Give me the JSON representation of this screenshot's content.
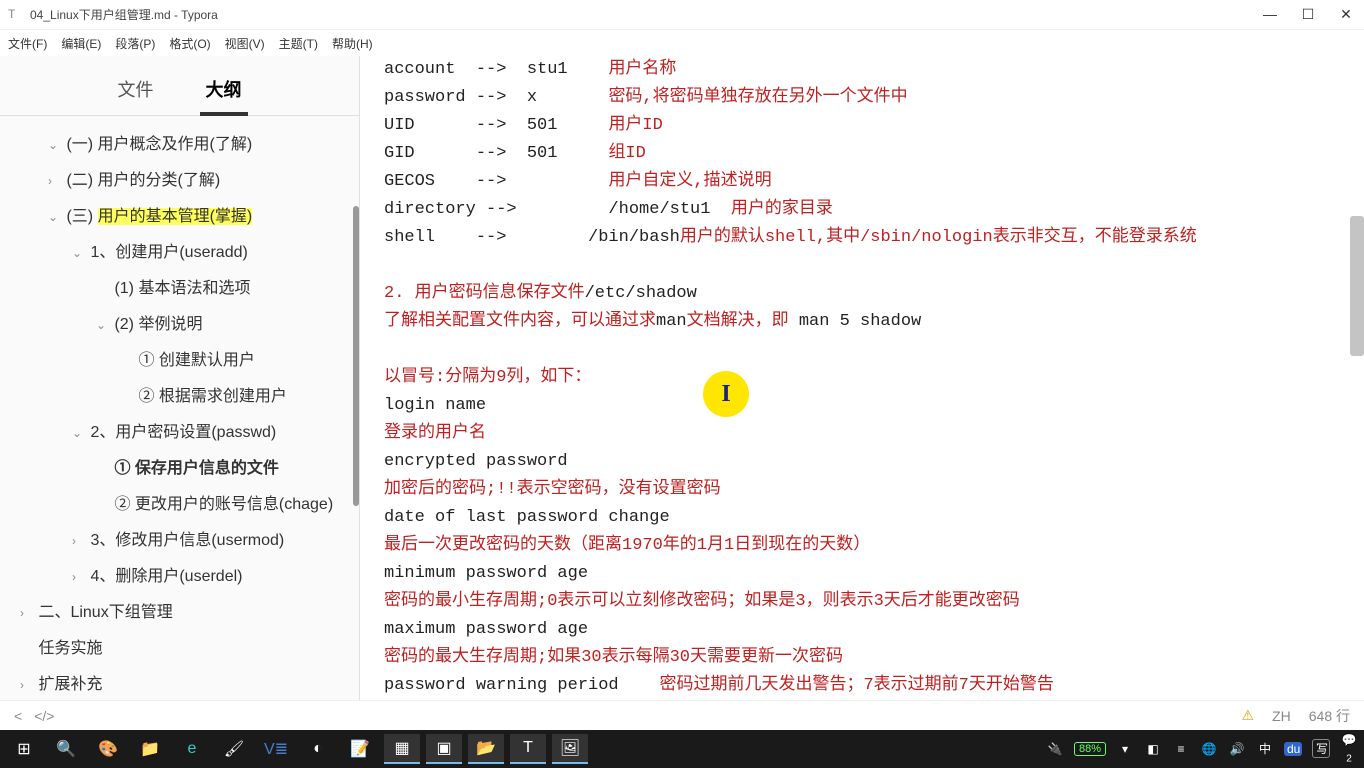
{
  "titlebar": {
    "title": "04_Linux下用户组管理.md - Typora"
  },
  "menubar": [
    "文件(F)",
    "编辑(E)",
    "段落(P)",
    "格式(O)",
    "视图(V)",
    "主题(T)",
    "帮助(H)"
  ],
  "tabs": {
    "file": "文件",
    "outline": "大纲"
  },
  "outline": [
    {
      "level": 1,
      "chev": "v",
      "text": "(一) 用户概念及作用(了解)",
      "hl": false
    },
    {
      "level": 1,
      "chev": ">",
      "text": "(二) 用户的分类(了解)",
      "hl": false
    },
    {
      "level": 1,
      "chev": "v",
      "text": "(三) ",
      "hl": false,
      "hltext": "用户的基本管理(掌握)"
    },
    {
      "level": 2,
      "chev": "v",
      "text": "1、创建用户(useradd)"
    },
    {
      "level": 3,
      "chev": "",
      "text": "(1) 基本语法和选项"
    },
    {
      "level": 3,
      "chev": "v",
      "text": "(2) 举例说明"
    },
    {
      "level": 4,
      "chev": "",
      "text": "① 创建默认用户"
    },
    {
      "level": 4,
      "chev": "",
      "text": "② 根据需求创建用户"
    },
    {
      "level": 2,
      "chev": "v",
      "text": "2、用户密码设置(passwd)"
    },
    {
      "level": 3,
      "chev": "",
      "text": "① 保存用户信息的文件",
      "bold": true
    },
    {
      "level": 3,
      "chev": "",
      "text": "② 更改用户的账号信息(chage)"
    },
    {
      "level": 2,
      "chev": ">",
      "text": "3、修改用户信息(usermod)"
    },
    {
      "level": 2,
      "chev": ">",
      "text": "4、删除用户(userdel)"
    },
    {
      "level": 0,
      "chev": ">",
      "text": "二、Linux下组管理"
    },
    {
      "level": 0,
      "chev": "",
      "text": "任务实施"
    },
    {
      "level": 0,
      "chev": ">",
      "text": "扩展补充"
    }
  ],
  "content": {
    "l1a": "account  -->  stu1    ",
    "l1b": "用户名称",
    "l2a": "password -->  x       ",
    "l2b": "密码,将密码单独存放在另外一个文件中",
    "l3a": "UID      -->  501     ",
    "l3b": "用户ID",
    "l4a": "GID      -->  501     ",
    "l4b": "组ID",
    "l5a": "GECOS    -->          ",
    "l5b": "用户自定义,描述说明",
    "l6a": "directory -->         /home/stu1  ",
    "l6b": "用户的家目录",
    "l7a": "shell    -->        /bin/bash",
    "l7b": "用户的默认shell,其中/sbin/nologin表示非交互，不能登录系统",
    "l8a": "2. 用户密码信息保存文件",
    "l8b": "/etc/shadow",
    "l9a": "了解相关配置文件内容，可以通过求",
    "l9b": "man",
    "l9c": "文档解决，即 ",
    "l9d": "man 5 shadow",
    "l10": "以冒号:分隔为9列，如下：",
    "l11": "login name",
    "l12": "登录的用户名",
    "l13": "encrypted password",
    "l14": "加密后的密码;!!表示空密码，没有设置密码",
    "l15": "date of last password change",
    "l16": "最后一次更改密码的天数（距离1970年的1月1日到现在的天数）",
    "l17": "minimum password age",
    "l18": "密码的最小生存周期;0表示可以立刻修改密码；如果是3，则表示3天后才能更改密码",
    "l19": "maximum password age",
    "l20": "密码的最大生存周期;如果30表示每隔30天需要更新一次密码",
    "l21": "password warning period",
    "l21b": "密码过期前几天发出警告；7表示过期前7天开始警告"
  },
  "statusbar": {
    "navback": "<",
    "breadcrumb": "</>",
    "warn": "⚠",
    "lang": "ZH",
    "lines": "648 行"
  },
  "tray": {
    "battery": "88%",
    "ime1": "中",
    "ime2": "du",
    "ime3": "写",
    "count": "2"
  }
}
